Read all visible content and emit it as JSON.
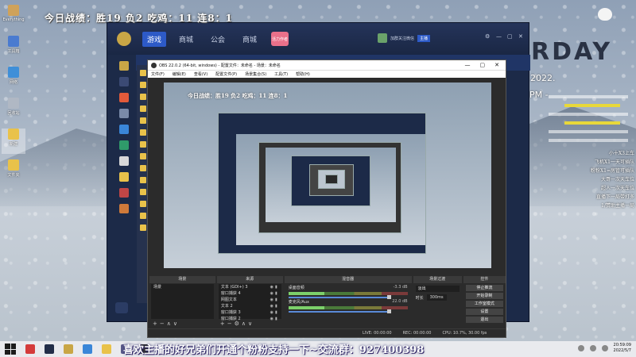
{
  "overlay": {
    "top_stats": "今日战绩：胜19  负2    吃鸡：11   连8：1",
    "bottom_banner": "喜欢主播的好兄弟们开通个粉粉支持一下~交流群：927400398",
    "right_notes": [
      "小十X3上车",
      "飞机X1一天可插队",
      "粉粉X1=房管可插队",
      "大哥一次天车位",
      "超人一次天车位",
      "直播下一局带打多",
      "1/赞助主播一局"
    ]
  },
  "background_page": {
    "title_fragment": "RDAY",
    "year": ", 2022.",
    "time": "PM -"
  },
  "desktop": {
    "icons": [
      {
        "label": "Everything",
        "color": "#cfa25a"
      },
      {
        "label": "工具箱",
        "color": "#4a7bd0"
      },
      {
        "label": "网络",
        "color": "#3f8fd8"
      },
      {
        "label": "回收站",
        "color": "#b0b8c4"
      },
      {
        "label": "新建",
        "color": "#e9c24a"
      },
      {
        "label": "文件夹",
        "color": "#e9c24a"
      }
    ]
  },
  "game": {
    "nav": [
      "游戏",
      "商城",
      "公会",
      "商城"
    ],
    "active_index": 0,
    "badge": "活力作者",
    "user": "加群关注微信",
    "kick": "主播",
    "win_controls": [
      "⚙",
      "—",
      "▢",
      "✕"
    ],
    "side_colors": [
      "#c9a646",
      "#3b4a74",
      "#e25a3a",
      "#7a8aa8",
      "#3a86d8",
      "#2f9a6a",
      "#d8d8d8",
      "#e9c24a",
      "#c04646",
      "#cf7a3a"
    ],
    "bottom_left": "11  12"
  },
  "obs": {
    "title": "OBS 22.0.2 (64-bit, windows) - 配置文件：未命名 - 场景：未命名",
    "menu": [
      "文件(F)",
      "编辑(E)",
      "查看(V)",
      "配置文件(P)",
      "场景集合(S)",
      "工具(T)",
      "帮助(H)"
    ],
    "win_controls": [
      "—",
      "▢",
      "✕"
    ],
    "docks": {
      "scenes": {
        "header": "场景",
        "items": [
          "场景"
        ]
      },
      "sources": {
        "header": "来源",
        "items": [
          "文本 (GDI+) 3",
          "窗口捕获 4",
          "网图文本",
          "文本 2",
          "窗口捕获 3",
          "窗口捕获 2"
        ]
      },
      "mixer": {
        "header": "混音器",
        "rows": [
          {
            "name": "桌面音频",
            "db": "-3.3 dB"
          },
          {
            "name": "麦克风/Aux",
            "db": "22.0 dB"
          }
        ]
      },
      "transitions": {
        "header": "场景过渡",
        "type": "淡出",
        "duration_label": "时长",
        "duration": "300ms"
      },
      "controls": {
        "header": "控件",
        "buttons": [
          "停止推流",
          "开始录制",
          "工作室模式",
          "设置",
          "退出"
        ]
      }
    },
    "status": {
      "live": "LIVE: 00:00:00",
      "rec": "REC: 00:00:00",
      "cpu": "CPU: 10.7%, 30.00 fps"
    }
  },
  "taskbar": {
    "apps": [
      {
        "name": "netease",
        "color": "#d43b3b"
      },
      {
        "name": "game",
        "color": "#222d48"
      },
      {
        "name": "pubg",
        "color": "#c9a646"
      },
      {
        "name": "chrome",
        "color": "#3a86d8"
      },
      {
        "name": "explorer",
        "color": "#e9c24a"
      },
      {
        "name": "app",
        "color": "#5a5a8a"
      },
      {
        "name": "obs",
        "color": "#303030"
      }
    ],
    "time": "20:59:09",
    "date": "2022/5/7"
  }
}
